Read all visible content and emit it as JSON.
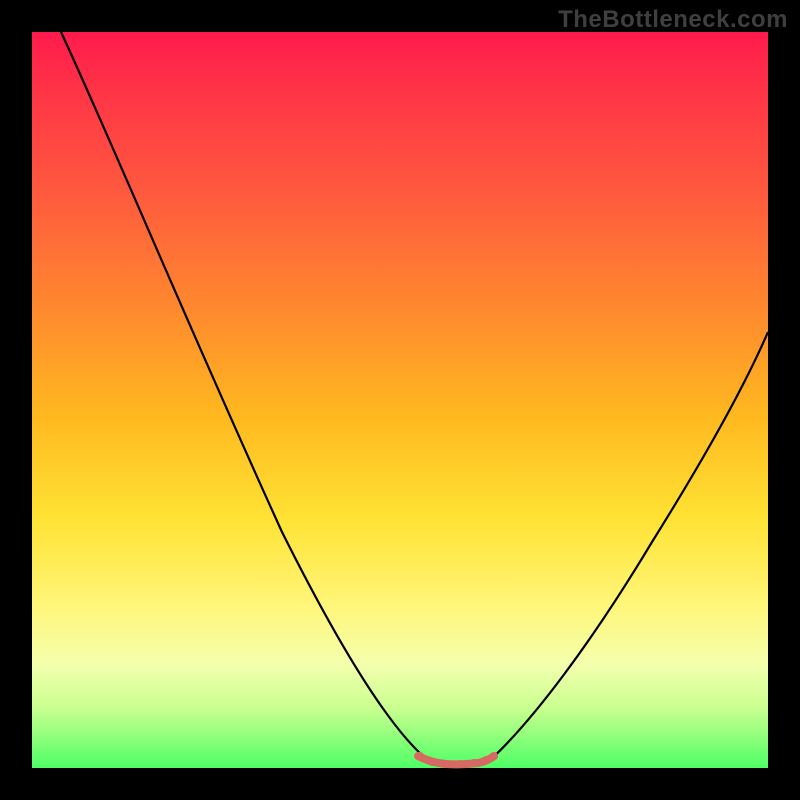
{
  "watermark": "TheBottleneck.com",
  "colors": {
    "page_bg": "#000000",
    "curve": "#000000",
    "accent_dots": "#d66a63",
    "gradient_top": "#ff1a4d",
    "gradient_bottom": "#4eff66"
  },
  "chart_data": {
    "type": "line",
    "title": "",
    "xlabel": "",
    "ylabel": "",
    "xlim": [
      0,
      100
    ],
    "ylim": [
      0,
      100
    ],
    "series": [
      {
        "name": "left-branch",
        "x": [
          4,
          10,
          16,
          22,
          28,
          34,
          40,
          46,
          50,
          54
        ],
        "y": [
          100,
          87,
          74,
          61,
          48,
          35,
          22,
          10,
          3,
          0
        ]
      },
      {
        "name": "right-branch",
        "x": [
          62,
          66,
          72,
          78,
          84,
          90,
          96,
          100
        ],
        "y": [
          0,
          3,
          10,
          20,
          31,
          42,
          53,
          60
        ]
      },
      {
        "name": "bottom-accent",
        "x": [
          52,
          54,
          56,
          58,
          60,
          62
        ],
        "y": [
          1.2,
          0.6,
          0.4,
          0.4,
          0.6,
          1.2
        ]
      }
    ]
  }
}
